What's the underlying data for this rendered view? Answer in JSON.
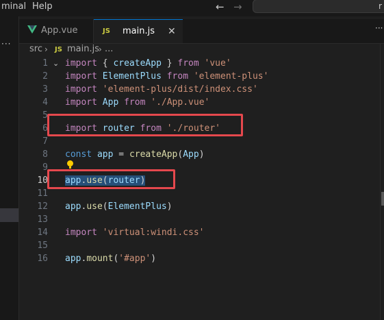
{
  "menu": {
    "terminal_partial": "minal",
    "help": "Help"
  },
  "titlebar": {
    "search_partial": "r"
  },
  "tabs": [
    {
      "label": "App.vue",
      "icon": "vue-icon"
    },
    {
      "label": "main.js",
      "icon": "js-icon",
      "icon_text": "JS",
      "close": "✕"
    }
  ],
  "breadcrumb": {
    "folder": "src",
    "file_icon": "JS",
    "file": "main.js",
    "more": "..."
  },
  "sidestrip": {
    "dots": "···"
  },
  "tabbar_more": "···",
  "lines": [
    {
      "n": "1",
      "tokens": [
        [
          "kw",
          "import"
        ],
        [
          "pn",
          " { "
        ],
        [
          "vr",
          "createApp"
        ],
        [
          "pn",
          " } "
        ],
        [
          "kw",
          "from"
        ],
        [
          "pn",
          " "
        ],
        [
          "st",
          "'vue'"
        ]
      ]
    },
    {
      "n": "2",
      "tokens": [
        [
          "kw",
          "import"
        ],
        [
          "pn",
          " "
        ],
        [
          "vr",
          "ElementPlus"
        ],
        [
          "pn",
          " "
        ],
        [
          "kw",
          "from"
        ],
        [
          "pn",
          " "
        ],
        [
          "st",
          "'element-plus'"
        ]
      ]
    },
    {
      "n": "3",
      "tokens": [
        [
          "kw",
          "import"
        ],
        [
          "pn",
          " "
        ],
        [
          "st",
          "'element-plus/dist/index.css'"
        ]
      ]
    },
    {
      "n": "4",
      "tokens": [
        [
          "kw",
          "import"
        ],
        [
          "pn",
          " "
        ],
        [
          "vr",
          "App"
        ],
        [
          "pn",
          " "
        ],
        [
          "kw",
          "from"
        ],
        [
          "pn",
          " "
        ],
        [
          "st",
          "'./App.vue'"
        ]
      ]
    },
    {
      "n": "5",
      "tokens": []
    },
    {
      "n": "6",
      "tokens": [
        [
          "kw",
          "import"
        ],
        [
          "pn",
          " "
        ],
        [
          "vr",
          "router"
        ],
        [
          "pn",
          " "
        ],
        [
          "kw",
          "from"
        ],
        [
          "pn",
          " "
        ],
        [
          "st",
          "'./router'"
        ]
      ]
    },
    {
      "n": "7",
      "tokens": []
    },
    {
      "n": "8",
      "tokens": [
        [
          "kw2",
          "const"
        ],
        [
          "pn",
          " "
        ],
        [
          "vr",
          "app"
        ],
        [
          "pn",
          " = "
        ],
        [
          "fn",
          "createApp"
        ],
        [
          "pn",
          "("
        ],
        [
          "vr",
          "App"
        ],
        [
          "pn",
          ")"
        ]
      ]
    },
    {
      "n": "9",
      "tokens": []
    },
    {
      "n": "10",
      "tokens": [
        [
          "vr",
          "app"
        ],
        [
          "pn",
          "."
        ],
        [
          "fn",
          "use"
        ],
        [
          "pn",
          "("
        ],
        [
          "vr",
          "router"
        ],
        [
          "pn",
          ")"
        ]
      ],
      "selected": true,
      "current": true
    },
    {
      "n": "11",
      "tokens": []
    },
    {
      "n": "12",
      "tokens": [
        [
          "vr",
          "app"
        ],
        [
          "pn",
          "."
        ],
        [
          "fn",
          "use"
        ],
        [
          "pn",
          "("
        ],
        [
          "vr",
          "ElementPlus"
        ],
        [
          "pn",
          ")"
        ]
      ]
    },
    {
      "n": "13",
      "tokens": []
    },
    {
      "n": "14",
      "tokens": [
        [
          "kw",
          "import"
        ],
        [
          "pn",
          " "
        ],
        [
          "st",
          "'virtual:windi.css'"
        ]
      ]
    },
    {
      "n": "15",
      "tokens": []
    },
    {
      "n": "16",
      "tokens": [
        [
          "vr",
          "app"
        ],
        [
          "pn",
          "."
        ],
        [
          "fn",
          "mount"
        ],
        [
          "pn",
          "("
        ],
        [
          "st",
          "'#app'"
        ],
        [
          "pn",
          ")"
        ]
      ]
    }
  ],
  "colors": {
    "keyword": "#c586c0",
    "string": "#ce9178",
    "variable": "#9cdcfe",
    "function": "#dcdcaa",
    "storage": "#569cd6",
    "highlight_box": "#e5484d",
    "selection": "#264f78",
    "active_tab_border": "#0078d4"
  }
}
